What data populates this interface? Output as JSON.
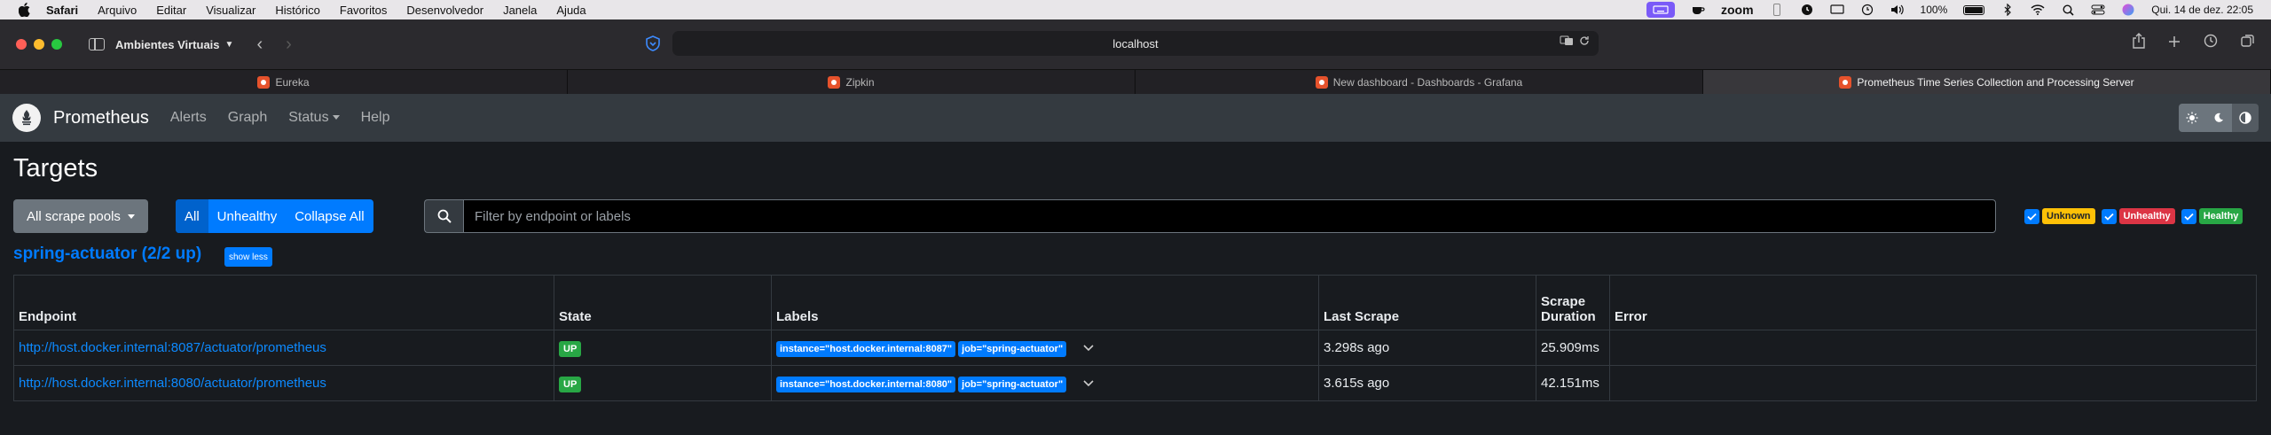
{
  "menubar": {
    "items": [
      "Safari",
      "Arquivo",
      "Editar",
      "Visualizar",
      "Histórico",
      "Favoritos",
      "Desenvolvedor",
      "Janela",
      "Ajuda"
    ],
    "zoom_label": "zoom",
    "battery": "100%",
    "datetime": "Qui. 14 de dez.  22:05"
  },
  "browser": {
    "tab_group": "Ambientes Virtuais",
    "url": "localhost",
    "tabs": [
      {
        "title": "Eureka"
      },
      {
        "title": "Zipkin"
      },
      {
        "title": "New dashboard - Dashboards - Grafana"
      },
      {
        "title": "Prometheus Time Series Collection and Processing Server"
      }
    ]
  },
  "navbar": {
    "brand": "Prometheus",
    "links": [
      "Alerts",
      "Graph",
      "Status",
      "Help"
    ]
  },
  "page": {
    "title": "Targets",
    "scrape_pools_button": "All scrape pools",
    "filter_buttons": [
      "All",
      "Unhealthy",
      "Collapse All"
    ],
    "search_placeholder": "Filter by endpoint or labels",
    "health_filters": [
      "Unknown",
      "Unhealthy",
      "Healthy"
    ]
  },
  "job": {
    "title": "spring-actuator (2/2 up)",
    "toggle_label": "show less",
    "columns": [
      "Endpoint",
      "State",
      "Labels",
      "Last Scrape",
      "Scrape Duration",
      "Error"
    ],
    "rows": [
      {
        "endpoint": "http://host.docker.internal:8087/actuator/prometheus",
        "state": "UP",
        "labels": [
          "instance=\"host.docker.internal:8087\"",
          "job=\"spring-actuator\""
        ],
        "last_scrape": "3.298s ago",
        "duration": "25.909ms",
        "error": ""
      },
      {
        "endpoint": "http://host.docker.internal:8080/actuator/prometheus",
        "state": "UP",
        "labels": [
          "instance=\"host.docker.internal:8080\"",
          "job=\"spring-actuator\""
        ],
        "last_scrape": "3.615s ago",
        "duration": "42.151ms",
        "error": ""
      }
    ]
  },
  "colors": {
    "primary": "#007bff",
    "success": "#28a745",
    "warning": "#ffc107",
    "danger": "#dc3545"
  }
}
